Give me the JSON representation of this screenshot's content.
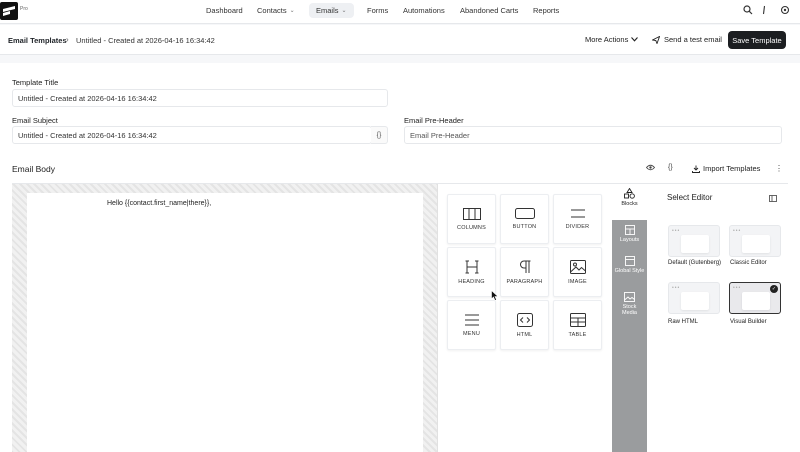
{
  "nav": {
    "logo_badge": "Pro",
    "items": [
      {
        "label": "Dashboard",
        "dropdown": false
      },
      {
        "label": "Contacts",
        "dropdown": true
      },
      {
        "label": "Emails",
        "dropdown": true,
        "active": true
      },
      {
        "label": "Forms",
        "dropdown": false
      },
      {
        "label": "Automations",
        "dropdown": false
      },
      {
        "label": "Abandoned Carts",
        "dropdown": false
      },
      {
        "label": "Reports",
        "dropdown": false
      }
    ],
    "right_icons": [
      "search-icon",
      "menu-icon",
      "settings-icon"
    ]
  },
  "header": {
    "breadcrumb_root": "Email Templates",
    "breadcrumb_current": "Untitled - Created at 2026-04-16 16:34:42",
    "more_actions_label": "More Actions",
    "send_test_label": "Send a test email",
    "save_label": "Save Template"
  },
  "form": {
    "template_title_label": "Template Title",
    "template_title_value": "Untitled - Created at 2026-04-16 16:34:42",
    "email_subject_label": "Email Subject",
    "email_subject_value": "Untitled - Created at 2026-04-16 16:34:42",
    "subject_smartcode_label": "{}",
    "pre_header_label": "Email Pre-Header",
    "pre_header_placeholder": "Email Pre-Header"
  },
  "email_body": {
    "label": "Email Body",
    "code_label": "{}",
    "import_label": "Import Templates",
    "canvas_text": "Hello {{contact.first_name|there}},"
  },
  "blocks": [
    {
      "label": "COLUMNS",
      "icon": "columns-icon"
    },
    {
      "label": "BUTTON",
      "icon": "button-icon"
    },
    {
      "label": "DIVIDER",
      "icon": "divider-icon"
    },
    {
      "label": "HEADING",
      "icon": "heading-icon"
    },
    {
      "label": "PARAGRAPH",
      "icon": "paragraph-icon"
    },
    {
      "label": "IMAGE",
      "icon": "image-icon"
    },
    {
      "label": "MENU",
      "icon": "menu-icon"
    },
    {
      "label": "HTML",
      "icon": "html-icon"
    },
    {
      "label": "TABLE",
      "icon": "table-icon"
    }
  ],
  "side_tabs": [
    {
      "label": "Blocks",
      "active": true
    },
    {
      "label": "Layouts"
    },
    {
      "label": "Global Style"
    },
    {
      "label": "Stock Media"
    }
  ],
  "select_editor": {
    "title": "Select Editor",
    "options": [
      {
        "label": "Default (Gutenberg)",
        "selected": false
      },
      {
        "label": "Classic Editor",
        "selected": false
      },
      {
        "label": "Raw HTML",
        "selected": false
      },
      {
        "label": "Visual Builder",
        "selected": true
      }
    ]
  },
  "colors": {
    "accent_dark": "#1c1e21",
    "side_tab_bg": "#9a9c9e",
    "page_bg": "#f6f7f9"
  }
}
